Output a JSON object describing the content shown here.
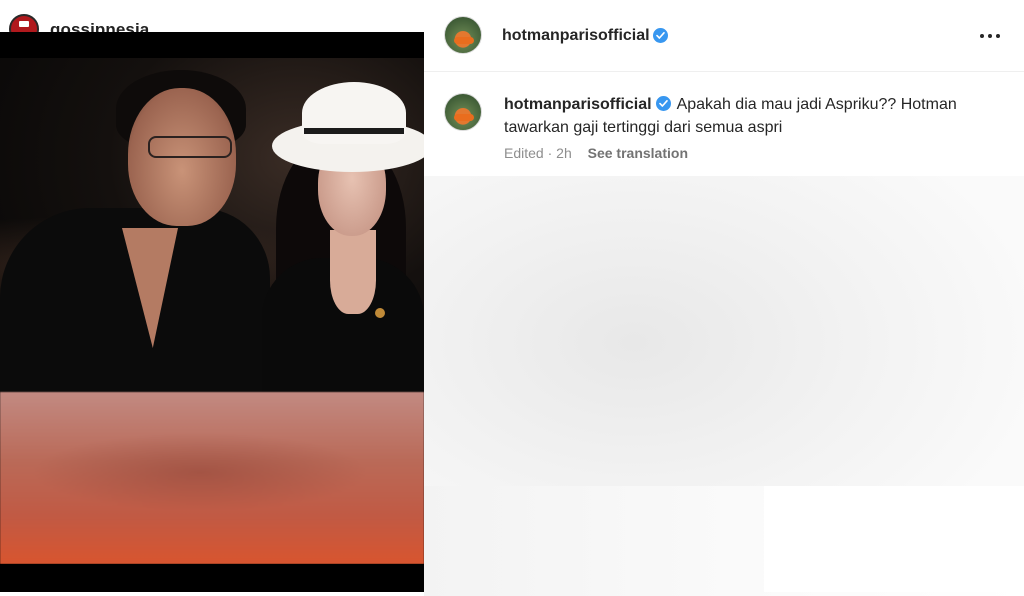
{
  "media": {
    "repost_account": "gossipnesia"
  },
  "post": {
    "author": {
      "username": "hotmanparisofficial",
      "verified": true
    },
    "caption": "Apakah dia mau jadi Aspriku?? Hotman tawarkan gaji tertinggi dari semua aspri",
    "edited_label": "Edited",
    "separator": "·",
    "time_ago": "2h",
    "see_translation_label": "See translation"
  },
  "icons": {
    "verified": "verified-badge-icon",
    "more": "more-options-icon"
  },
  "colors": {
    "verified_blue": "#3897f0",
    "text_primary": "#262626",
    "text_secondary": "#8e8e8e"
  }
}
